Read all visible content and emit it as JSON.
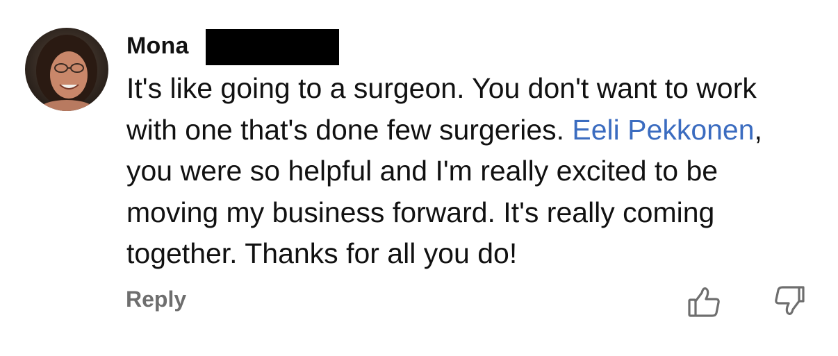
{
  "comment": {
    "author": {
      "first_name": "Mona",
      "avatar_icon": "user-avatar-photo"
    },
    "text_before_mention": "It's like going to a surgeon. You don't want to work with one that's done few surgeries. ",
    "mention": "Eeli Pekkonen",
    "text_after_mention": ", you were so helpful and I'm really excited to be moving my business forward. It's really coming together. Thanks for all you do!",
    "actions": {
      "reply_label": "Reply",
      "like_icon": "thumbs-up-icon",
      "dislike_icon": "thumbs-down-icon"
    }
  },
  "colors": {
    "mention": "#3b6cc0",
    "action_gray": "#6e6e6e",
    "text": "#111111",
    "redaction": "#000000"
  }
}
